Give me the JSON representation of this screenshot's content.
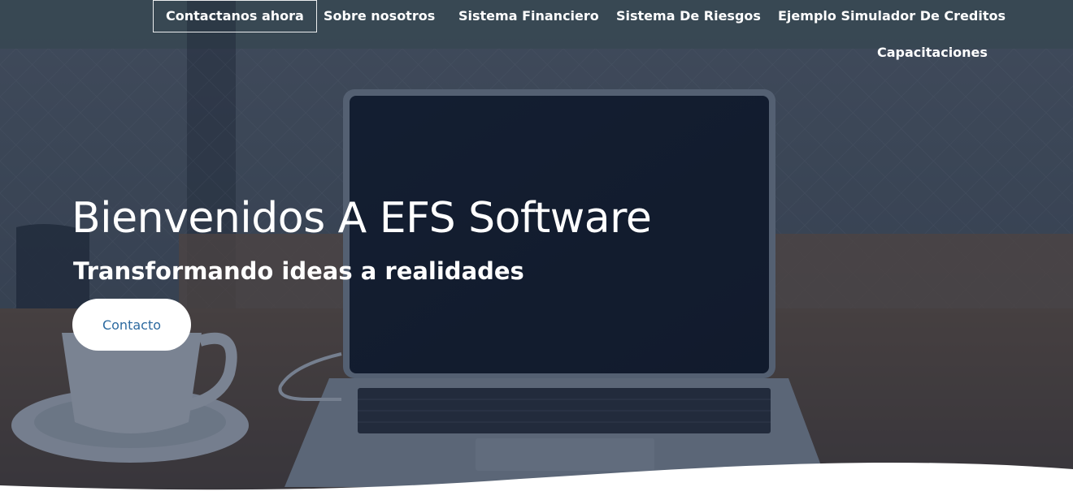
{
  "nav": {
    "items": [
      {
        "label": "Contactanos ahora",
        "active": true
      },
      {
        "label": "Sobre nosotros"
      },
      {
        "label": "Sistema Financiero"
      },
      {
        "label": "Sistema De Riesgos"
      },
      {
        "label": "Ejemplo Simulador De Creditos"
      },
      {
        "label": "Capacitaciones"
      }
    ]
  },
  "hero": {
    "title": "Bienvenidos A EFS Software",
    "subtitle": "Transformando ideas a realidades",
    "cta_label": "Contacto",
    "background_description_icons": [
      "laptop-image",
      "coffee-cup-image"
    ]
  },
  "colors": {
    "overlay": "#1b2a44",
    "cta_text": "#2c6aa0",
    "text": "#ffffff"
  }
}
